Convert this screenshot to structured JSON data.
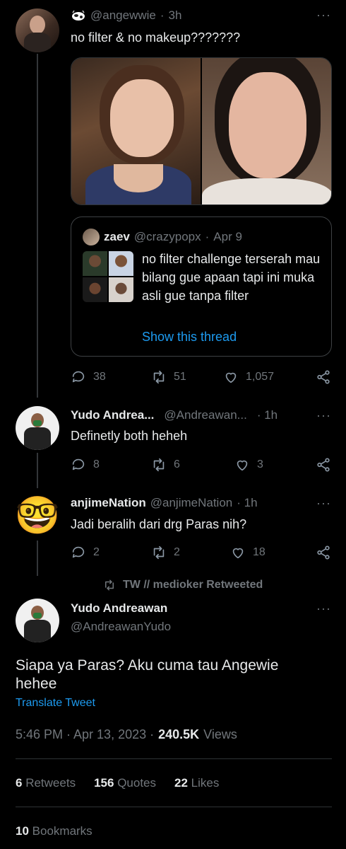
{
  "tweet1": {
    "handle": "@angewwie",
    "time": "3h",
    "separator": "·",
    "text": "no filter & no makeup???????",
    "quote": {
      "name": "zaev",
      "handle": "@crazypopx",
      "date": "Apr 9",
      "text": "no filter challenge terserah mau bilang gue apaan tapi ini muka asli gue tanpa filter",
      "show_thread": "Show this thread"
    },
    "replies": "38",
    "retweets": "51",
    "likes": "1,057"
  },
  "reply1": {
    "name": "Yudo Andrea...",
    "handle": "@Andreawan...",
    "time": "· 1h",
    "text": "Definetly both heheh",
    "replies": "8",
    "retweets": "6",
    "likes": "3"
  },
  "reply2": {
    "name": "anjimeNation",
    "handle": "@anjimeNation",
    "time": "· 1h",
    "text": "Jadi beralih dari drg Paras nih?",
    "emoji": "🤓",
    "replies": "2",
    "retweets": "2",
    "likes": "18"
  },
  "retweeted_by": "TW // medioker Retweeted",
  "main": {
    "name": "Yudo Andreawan",
    "handle": "@AndreawanYudo",
    "text": "Siapa ya Paras? Aku cuma tau Angewie hehee",
    "translate": "Translate Tweet",
    "timestamp": "5:46 PM · Apr 13, 2023 ·",
    "views_count": "240.5K",
    "views_label": "Views",
    "retweets_count": "6",
    "retweets_label": "Retweets",
    "quotes_count": "156",
    "quotes_label": "Quotes",
    "likes_count": "22",
    "likes_label": "Likes",
    "bookmarks_count": "10",
    "bookmarks_label": "Bookmarks"
  },
  "icons": {
    "more": "more-icon",
    "reply": "reply-icon",
    "retweet": "retweet-icon",
    "like": "heart-icon",
    "share": "share-icon"
  }
}
